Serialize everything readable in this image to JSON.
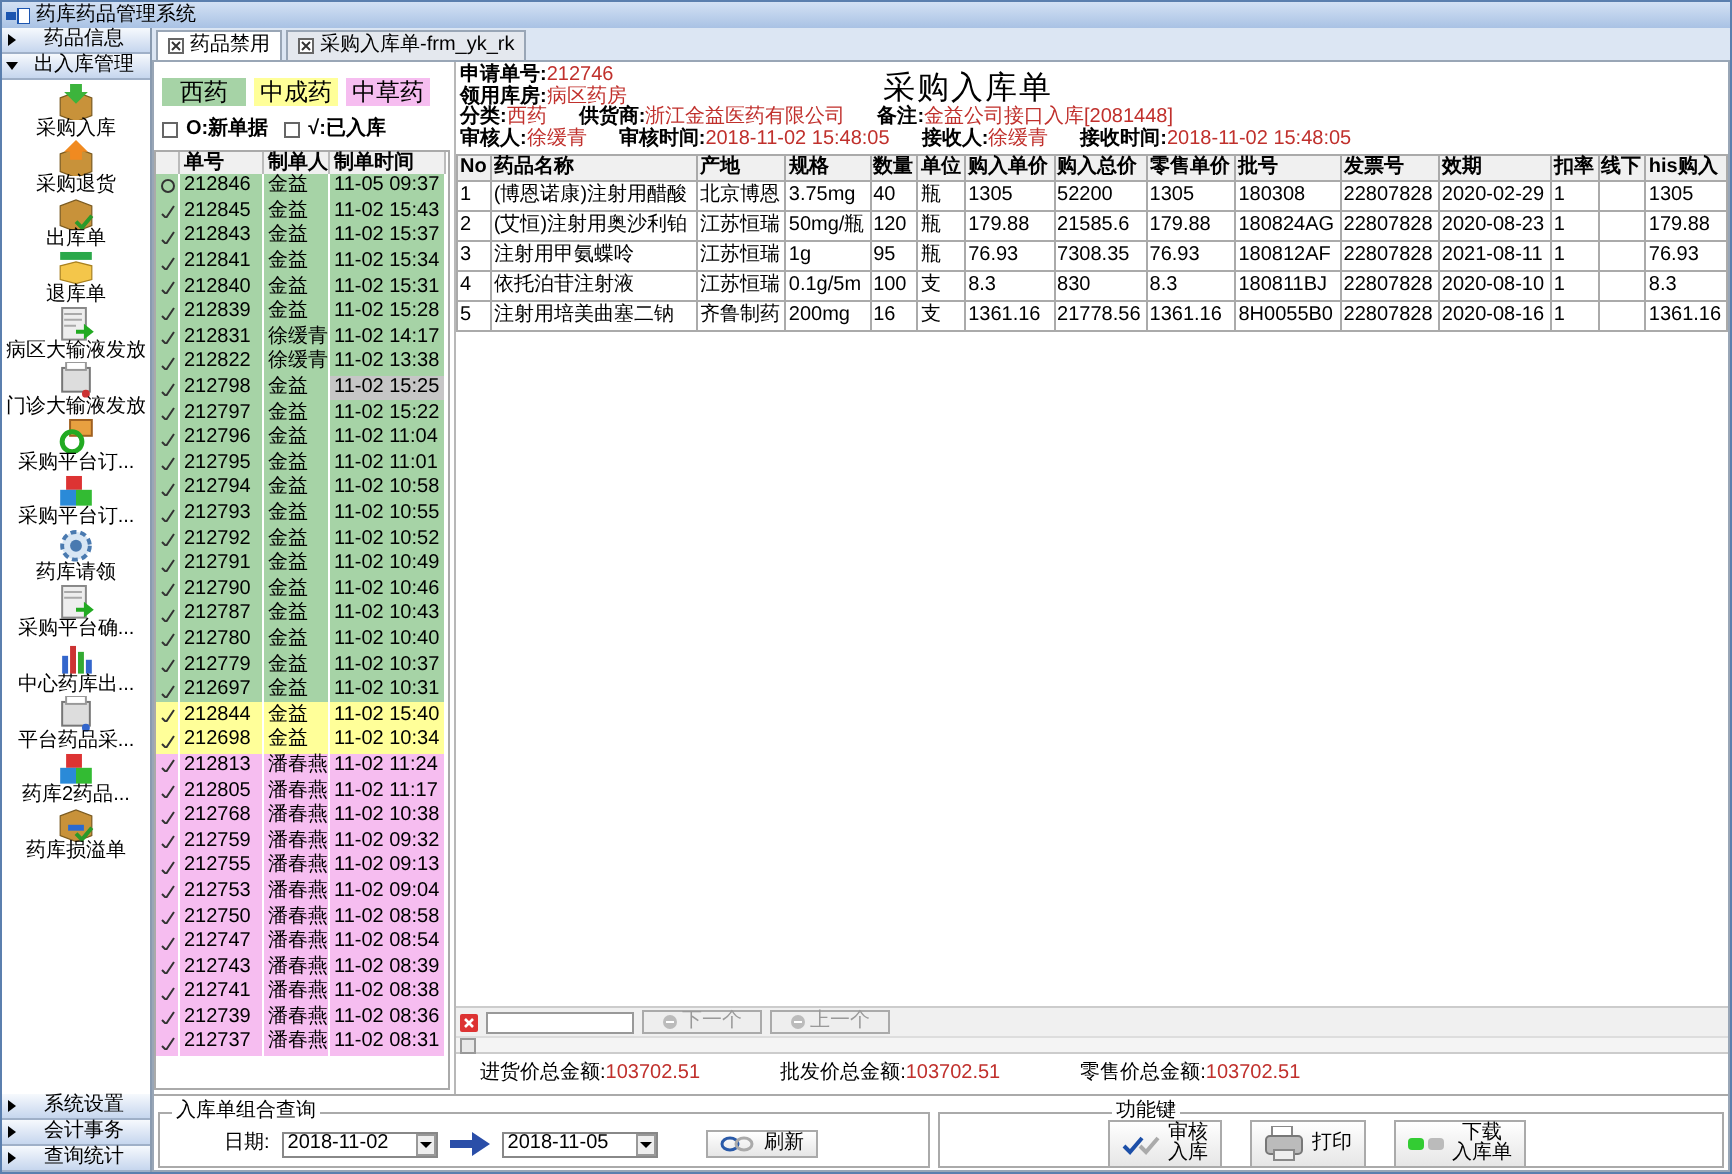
{
  "window": {
    "title": "药库药品管理系统"
  },
  "sidebar": {
    "sections": [
      {
        "label": "药品信息",
        "expanded": false
      },
      {
        "label": "出入库管理",
        "expanded": true,
        "items": [
          {
            "label": "采购入库"
          },
          {
            "label": "采购退货"
          },
          {
            "label": "出库单"
          },
          {
            "label": "退库单"
          },
          {
            "label": "病区大输液发放"
          },
          {
            "label": "门诊大输液发放"
          },
          {
            "label": "采购平台订..."
          },
          {
            "label": "采购平台订..."
          },
          {
            "label": "药库请领"
          },
          {
            "label": "采购平台确..."
          },
          {
            "label": "中心药库出..."
          },
          {
            "label": "平台药品采..."
          },
          {
            "label": "药库2药品..."
          },
          {
            "label": "药库损溢单"
          }
        ]
      },
      {
        "label": "系统设置",
        "expanded": false
      },
      {
        "label": "会计事务",
        "expanded": false
      },
      {
        "label": "查询统计",
        "expanded": false
      }
    ]
  },
  "tabs": [
    {
      "label": "药品禁用",
      "selected": true
    },
    {
      "label": "采购入库单-frm_yk_rk",
      "selected": false
    }
  ],
  "order_list": {
    "legend": [
      {
        "label": "西药",
        "color": "#a6d3a6"
      },
      {
        "label": "中成药",
        "color": "#ffff99"
      },
      {
        "label": "中草药",
        "color": "#f6bdf0"
      }
    ],
    "filters": [
      {
        "label": "O:新单据",
        "checked": false
      },
      {
        "label": "√:已入库",
        "checked": false
      }
    ],
    "columns": [
      "单号",
      "制单人",
      "制单时间"
    ],
    "rows": [
      {
        "stored": false,
        "number": "212846",
        "maker": "金益",
        "time": "11-05 09:37",
        "color": "#a6d3a6",
        "selected": false
      },
      {
        "stored": true,
        "number": "212845",
        "maker": "金益",
        "time": "11-02 15:43",
        "color": "#a6d3a6",
        "selected": false
      },
      {
        "stored": true,
        "number": "212843",
        "maker": "金益",
        "time": "11-02 15:37",
        "color": "#a6d3a6",
        "selected": false
      },
      {
        "stored": true,
        "number": "212841",
        "maker": "金益",
        "time": "11-02 15:34",
        "color": "#a6d3a6",
        "selected": false
      },
      {
        "stored": true,
        "number": "212840",
        "maker": "金益",
        "time": "11-02 15:31",
        "color": "#a6d3a6",
        "selected": false
      },
      {
        "stored": true,
        "number": "212839",
        "maker": "金益",
        "time": "11-02 15:28",
        "color": "#a6d3a6",
        "selected": false
      },
      {
        "stored": true,
        "number": "212831",
        "maker": "徐缓青",
        "time": "11-02 14:17",
        "color": "#a6d3a6",
        "selected": false
      },
      {
        "stored": true,
        "number": "212822",
        "maker": "徐缓青",
        "time": "11-02 13:38",
        "color": "#a6d3a6",
        "selected": false
      },
      {
        "stored": true,
        "number": "212798",
        "maker": "金益",
        "time": "11-02 15:25",
        "color": "#a6d3a6",
        "selected": true
      },
      {
        "stored": true,
        "number": "212797",
        "maker": "金益",
        "time": "11-02 15:22",
        "color": "#a6d3a6",
        "selected": false
      },
      {
        "stored": true,
        "number": "212796",
        "maker": "金益",
        "time": "11-02 11:04",
        "color": "#a6d3a6",
        "selected": false
      },
      {
        "stored": true,
        "number": "212795",
        "maker": "金益",
        "time": "11-02 11:01",
        "color": "#a6d3a6",
        "selected": false
      },
      {
        "stored": true,
        "number": "212794",
        "maker": "金益",
        "time": "11-02 10:58",
        "color": "#a6d3a6",
        "selected": false
      },
      {
        "stored": true,
        "number": "212793",
        "maker": "金益",
        "time": "11-02 10:55",
        "color": "#a6d3a6",
        "selected": false
      },
      {
        "stored": true,
        "number": "212792",
        "maker": "金益",
        "time": "11-02 10:52",
        "color": "#a6d3a6",
        "selected": false
      },
      {
        "stored": true,
        "number": "212791",
        "maker": "金益",
        "time": "11-02 10:49",
        "color": "#a6d3a6",
        "selected": false
      },
      {
        "stored": true,
        "number": "212790",
        "maker": "金益",
        "time": "11-02 10:46",
        "color": "#a6d3a6",
        "selected": false
      },
      {
        "stored": true,
        "number": "212787",
        "maker": "金益",
        "time": "11-02 10:43",
        "color": "#a6d3a6",
        "selected": false
      },
      {
        "stored": true,
        "number": "212780",
        "maker": "金益",
        "time": "11-02 10:40",
        "color": "#a6d3a6",
        "selected": false
      },
      {
        "stored": true,
        "number": "212779",
        "maker": "金益",
        "time": "11-02 10:37",
        "color": "#a6d3a6",
        "selected": false
      },
      {
        "stored": true,
        "number": "212697",
        "maker": "金益",
        "time": "11-02 10:31",
        "color": "#a6d3a6",
        "selected": false
      },
      {
        "stored": true,
        "number": "212844",
        "maker": "金益",
        "time": "11-02 15:40",
        "color": "#ffff99",
        "selected": false
      },
      {
        "stored": true,
        "number": "212698",
        "maker": "金益",
        "time": "11-02 10:34",
        "color": "#ffff99",
        "selected": false
      },
      {
        "stored": true,
        "number": "212813",
        "maker": "潘春燕",
        "time": "11-02 11:24",
        "color": "#f6bdf0",
        "selected": false
      },
      {
        "stored": true,
        "number": "212805",
        "maker": "潘春燕",
        "time": "11-02 11:17",
        "color": "#f6bdf0",
        "selected": false
      },
      {
        "stored": true,
        "number": "212768",
        "maker": "潘春燕",
        "time": "11-02 10:38",
        "color": "#f6bdf0",
        "selected": false
      },
      {
        "stored": true,
        "number": "212759",
        "maker": "潘春燕",
        "time": "11-02 09:32",
        "color": "#f6bdf0",
        "selected": false
      },
      {
        "stored": true,
        "number": "212755",
        "maker": "潘春燕",
        "time": "11-02 09:13",
        "color": "#f6bdf0",
        "selected": false
      },
      {
        "stored": true,
        "number": "212753",
        "maker": "潘春燕",
        "time": "11-02 09:04",
        "color": "#f6bdf0",
        "selected": false
      },
      {
        "stored": true,
        "number": "212750",
        "maker": "潘春燕",
        "time": "11-02 08:58",
        "color": "#f6bdf0",
        "selected": false
      },
      {
        "stored": true,
        "number": "212747",
        "maker": "潘春燕",
        "time": "11-02 08:54",
        "color": "#f6bdf0",
        "selected": false
      },
      {
        "stored": true,
        "number": "212743",
        "maker": "潘春燕",
        "time": "11-02 08:39",
        "color": "#f6bdf0",
        "selected": false
      },
      {
        "stored": true,
        "number": "212741",
        "maker": "潘春燕",
        "time": "11-02 08:38",
        "color": "#f6bdf0",
        "selected": false
      },
      {
        "stored": true,
        "number": "212739",
        "maker": "潘春燕",
        "time": "11-02 08:36",
        "color": "#f6bdf0",
        "selected": false
      },
      {
        "stored": true,
        "number": "212737",
        "maker": "潘春燕",
        "time": "11-02 08:31",
        "color": "#f6bdf0",
        "selected": false
      }
    ]
  },
  "form": {
    "title": "采购入库单",
    "info": [
      [
        {
          "label": "申请单号:",
          "value": "212746"
        }
      ],
      [
        {
          "label": "领用库房:",
          "value": "病区药房"
        }
      ],
      [
        {
          "label": "分类:",
          "value": "西药"
        },
        {
          "label": "供货商:",
          "value": "浙江金益医药有限公司"
        },
        {
          "label": "备注:",
          "value": "金益公司接口入库[2081448]"
        }
      ],
      [
        {
          "label": "审核人:",
          "value": "徐缓青"
        },
        {
          "label": "审核时间:",
          "value": "2018-11-02 15:48:05"
        },
        {
          "label": "接收人:",
          "value": "徐缓青"
        },
        {
          "label": "接收时间:",
          "value": "2018-11-02 15:48:05"
        }
      ]
    ],
    "columns": [
      "No",
      "药品名称",
      "产地",
      "规格",
      "数量",
      "单位",
      "购入单价",
      "购入总价",
      "零售单价",
      "批号",
      "发票号",
      "效期",
      "扣率",
      "线下",
      "his购入"
    ],
    "rows": [
      {
        "cells": [
          "1",
          "(博恩诺康)注射用醋酸",
          "北京博恩",
          "3.75mg",
          "40",
          "瓶",
          "1305",
          "52200",
          "1305",
          "180308",
          "22807828",
          "2020-02-29",
          "1",
          null,
          "1305"
        ]
      },
      {
        "cells": [
          "2",
          "(艾恒)注射用奥沙利铂",
          "江苏恒瑞",
          "50mg/瓶",
          "120",
          "瓶",
          "179.88",
          "21585.6",
          "179.88",
          "180824AG",
          "22807828",
          "2020-08-23",
          "1",
          null,
          "179.88"
        ]
      },
      {
        "cells": [
          "3",
          "注射用甲氨蝶呤",
          "江苏恒瑞",
          "1g",
          "95",
          "瓶",
          "76.93",
          "7308.35",
          "76.93",
          "180812AF",
          "22807828",
          "2021-08-11",
          "1",
          null,
          "76.93"
        ]
      },
      {
        "cells": [
          "4",
          "依托泊苷注射液",
          "江苏恒瑞",
          "0.1g/5m",
          "100",
          "支",
          "8.3",
          "830",
          "8.3",
          "180811BJ",
          "22807828",
          "2020-08-10",
          "1",
          null,
          "8.3"
        ]
      },
      {
        "cells": [
          "5",
          "注射用培美曲塞二钠",
          "齐鲁制药",
          "200mg",
          "16",
          "支",
          "1361.16",
          "21778.56",
          "1361.16",
          "8H0055B0",
          "22807828",
          "2020-08-16",
          "1",
          null,
          "1361.16"
        ]
      }
    ],
    "search": {
      "buttons": [
        {
          "label": "下一个",
          "disabled": true
        },
        {
          "label": "上一个",
          "disabled": true
        }
      ]
    },
    "totals": [
      {
        "label": "进货价总金额:",
        "value": "103702.51"
      },
      {
        "label": "批发价总金额:",
        "value": "103702.51"
      },
      {
        "label": "零售价总金额:",
        "value": "103702.51"
      }
    ]
  },
  "query": {
    "title": "入库单组合查询",
    "date_label": "日期:",
    "date_from": "2018-11-02",
    "date_to": "2018-11-05",
    "refresh": "刷新"
  },
  "function_keys": {
    "title": "功能键",
    "buttons": [
      {
        "kind": "approve",
        "lines": [
          "审核",
          "入库"
        ]
      },
      {
        "kind": "print",
        "lines": [
          "打印"
        ]
      },
      {
        "kind": "download",
        "lines": [
          "下载",
          "入库单"
        ]
      }
    ]
  }
}
